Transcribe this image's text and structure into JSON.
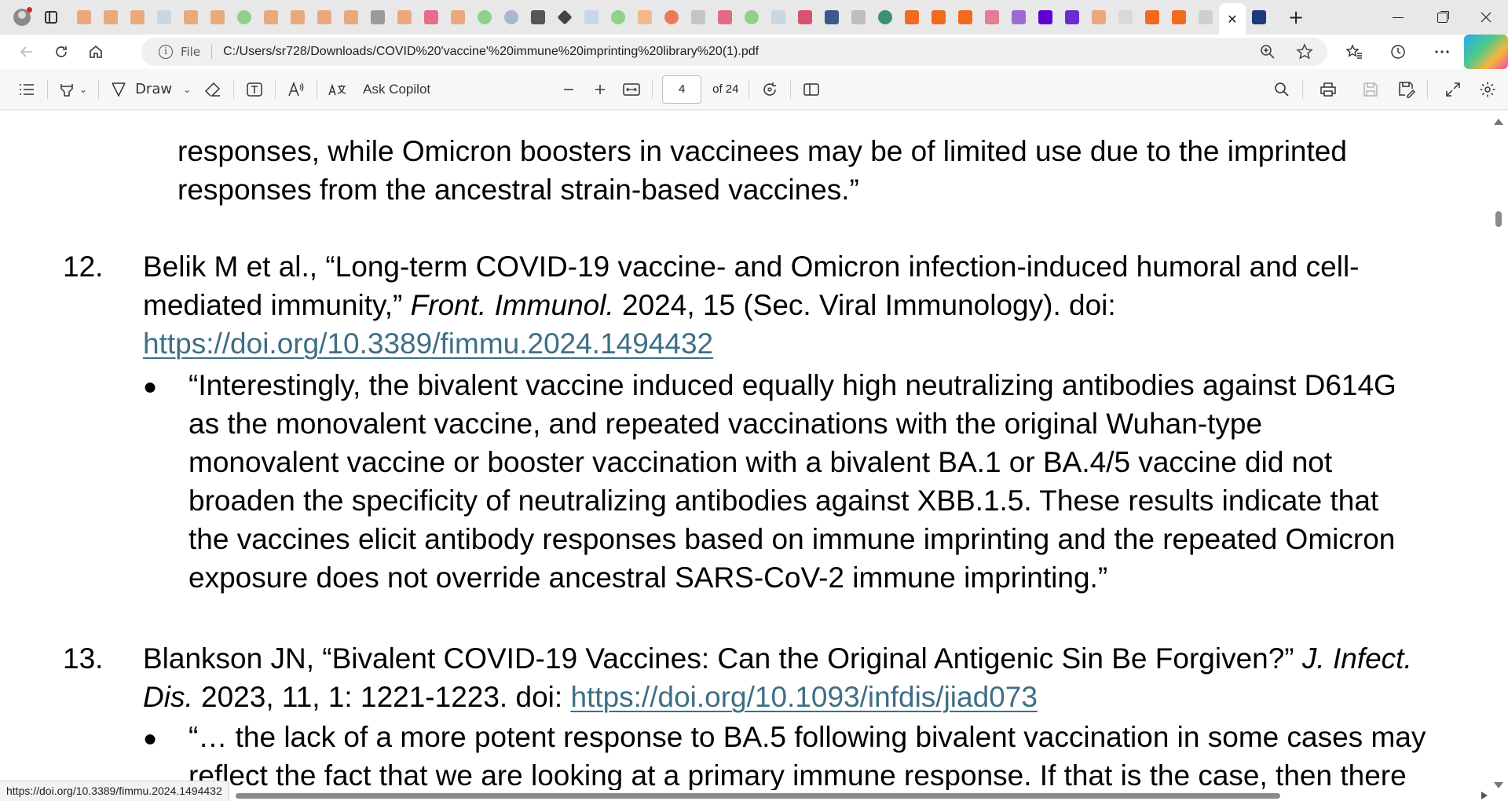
{
  "browser": {
    "tab_close_label": "✕",
    "new_tab_label": "+",
    "address": {
      "scheme_label": "File",
      "url": "C:/Users/sr728/Downloads/COVID%20'vaccine'%20immune%20imprinting%20library%20(1).pdf"
    }
  },
  "pdf_toolbar": {
    "draw_label": "Draw",
    "ask_copilot_label": "Ask Copilot",
    "current_page": "4",
    "page_count_label": "of 24"
  },
  "document": {
    "top_quote_lines": [
      "responses, while Omicron boosters in vaccinees may be of limited use due to the imprinted",
      "responses from the ancestral strain-based vaccines.”"
    ],
    "ref12": {
      "number": "12.",
      "line1": "Belik M et al., “Long-term COVID-19 vaccine- and Omicron infection-induced humoral and cell-",
      "line2_a": "mediated immunity,” ",
      "journal": "Front. Immunol.",
      "line2_b": " 2024, 15 (Sec. Viral Immunology). doi:",
      "doi_link": "https://doi.org/10.3389/fimmu.2024.1494432",
      "bullet": "●",
      "quote_lines": [
        "“Interestingly, the bivalent vaccine induced equally high neutralizing antibodies against D614G",
        "as the monovalent vaccine, and repeated vaccinations with the original Wuhan-type",
        "monovalent vaccine or booster vaccination with a bivalent BA.1 or BA.4/5 vaccine did not",
        "broaden the specificity of neutralizing antibodies against XBB.1.5. These results indicate that",
        "the vaccines elicit antibody responses based on immune imprinting and the repeated Omicron",
        "exposure does not override ancestral SARS-CoV-2 immune imprinting.”"
      ]
    },
    "ref13": {
      "number": "13.",
      "line1_a": "Blankson JN, “Bivalent COVID-19 Vaccines: Can the Original Antigenic Sin Be Forgiven?” ",
      "journal1": "J. Infect.",
      "journal2": "Dis.",
      "line2_b": " 2023, 11, 1: 1221-1223. doi: ",
      "doi_link": "https://doi.org/10.1093/infdis/jiad073",
      "bullet": "●",
      "quote_line1": "“… the lack of a more potent response to BA.5 following bivalent vaccination in some cases may",
      "quote_line2": "reflect the fact that we are looking at a primary immune response. If that is the case, then there"
    }
  },
  "status_bar": {
    "hover_url": "https://doi.org/10.3389/fimmu.2024.1494432"
  },
  "colors": {
    "link": "#3d6f86",
    "accent": "#0f6cbd"
  }
}
